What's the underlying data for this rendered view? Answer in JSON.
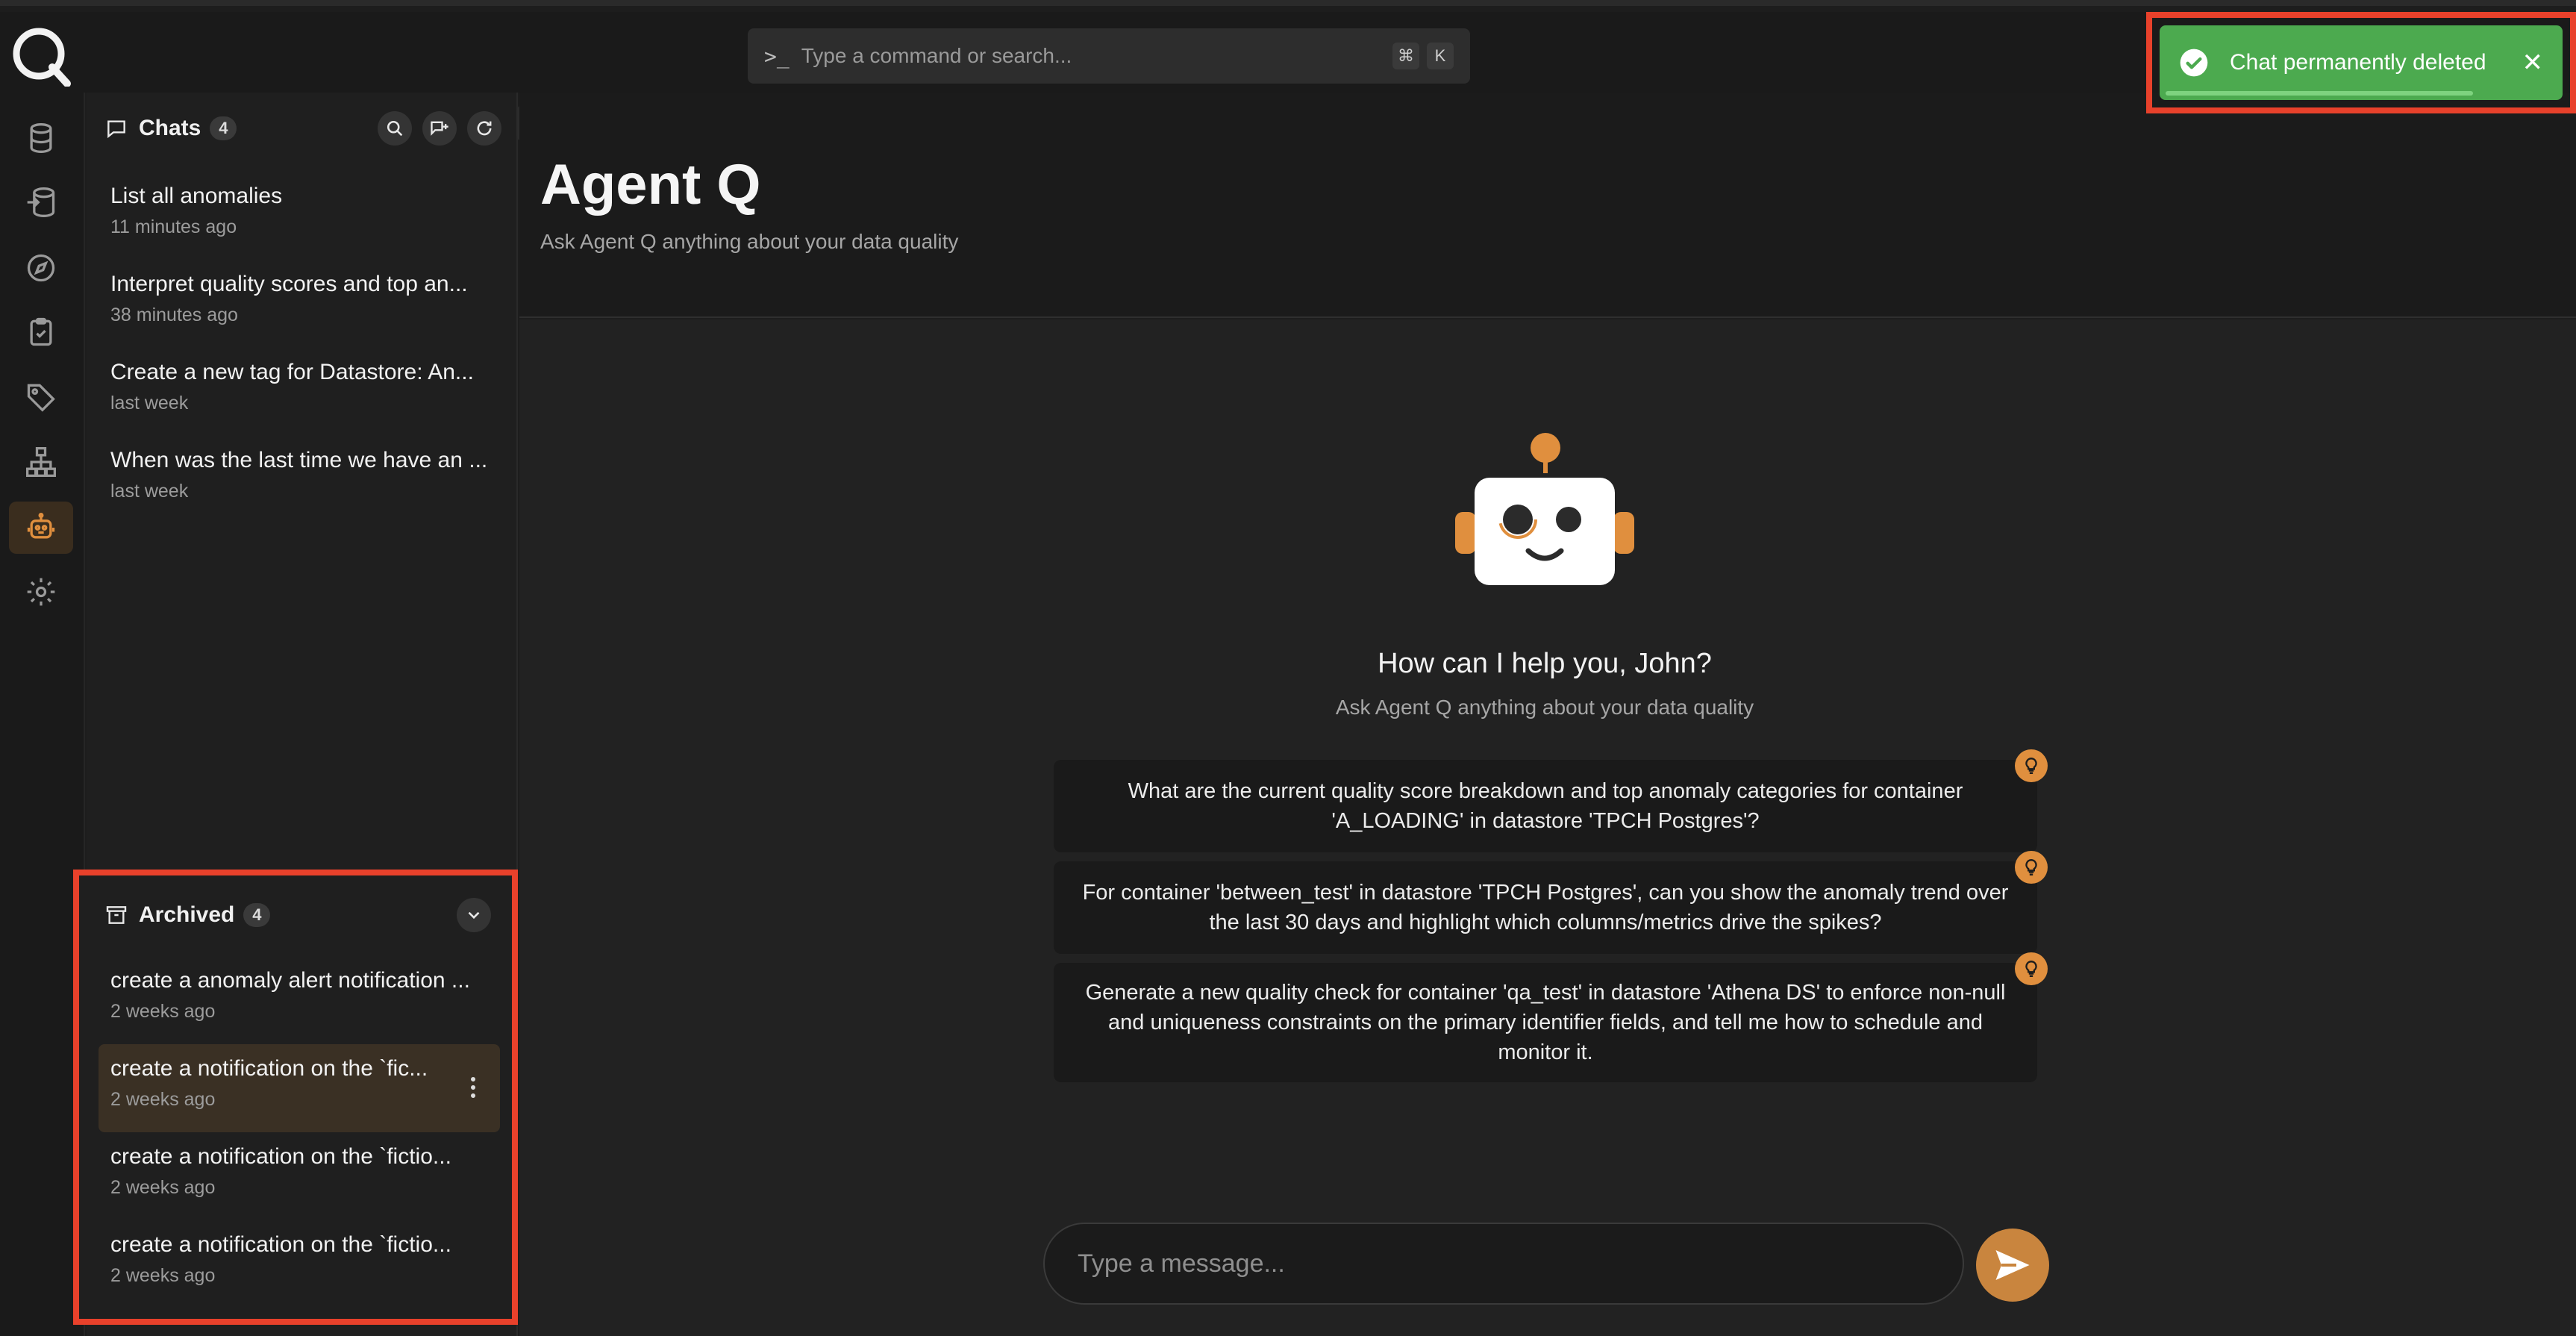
{
  "topbar": {
    "command_placeholder": "Type a command or search...",
    "kbd_cmd": "⌘",
    "kbd_k": "K"
  },
  "rail": {
    "items": [
      "datastores",
      "sources",
      "explore",
      "checks",
      "tags",
      "lineage",
      "agent-q",
      "settings"
    ],
    "active": "agent-q"
  },
  "chats": {
    "title": "Chats",
    "count": "4",
    "items": [
      {
        "title": "List all anomalies",
        "time": "11 minutes ago"
      },
      {
        "title": "Interpret quality scores and top an...",
        "time": "38 minutes ago"
      },
      {
        "title": "Create a new tag for Datastore: An...",
        "time": "last week"
      },
      {
        "title": "When was the last time we have an ...",
        "time": "last week"
      }
    ]
  },
  "archived": {
    "title": "Archived",
    "count": "4",
    "items": [
      {
        "title": "create a anomaly alert notification ...",
        "time": "2 weeks ago"
      },
      {
        "title": "create a notification on the `fic...",
        "time": "2 weeks ago"
      },
      {
        "title": "create a notification on the `fictio...",
        "time": "2 weeks ago"
      },
      {
        "title": "create a notification on the `fictio...",
        "time": "2 weeks ago"
      }
    ]
  },
  "main": {
    "title": "Agent Q",
    "subtitle": "Ask Agent Q anything about your data quality",
    "greeting": "How can I help you, John?",
    "greeting_sub": "Ask Agent Q anything about your data quality",
    "suggestions": [
      "What are the current quality score breakdown and top anomaly categories for container 'A_LOADING' in datastore 'TPCH Postgres'?",
      "For container 'between_test' in datastore 'TPCH Postgres', can you show the anomaly trend over the last 30 days and highlight which columns/metrics drive the spikes?",
      "Generate a new quality check for container 'qa_test' in datastore 'Athena DS' to enforce non-null and uniqueness constraints on the primary identifier fields, and tell me how to schedule and monitor it."
    ],
    "message_placeholder": "Type a message..."
  },
  "toast": {
    "message": "Chat permanently deleted",
    "close": "✕"
  },
  "colors": {
    "accent": "#e08f3e",
    "success": "#4caa4f",
    "highlight": "#e8412b"
  }
}
